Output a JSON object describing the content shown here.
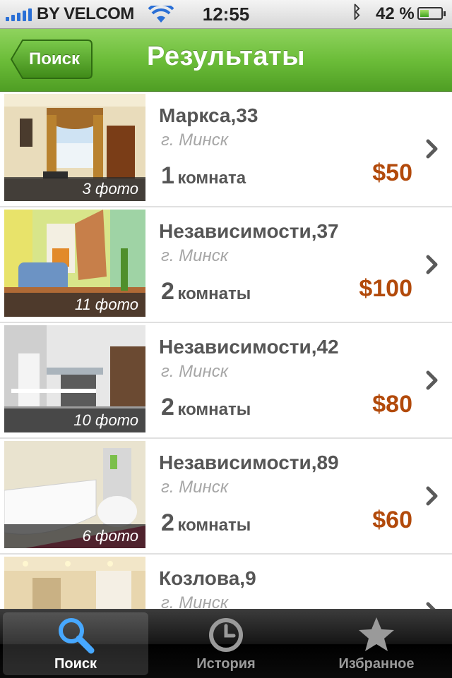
{
  "status_bar": {
    "carrier": "BY VELCOM",
    "time": "12:55",
    "battery_percent_label": "42 %",
    "battery_level": 0.42
  },
  "nav": {
    "back_label": "Поиск",
    "title": "Результаты"
  },
  "listings": [
    {
      "address": "Маркса,33",
      "city": "г. Минск",
      "rooms_num": "1",
      "rooms_word": "комната",
      "price": "$50",
      "photo_count": "3 фото"
    },
    {
      "address": "Независимости,37",
      "city": "г. Минск",
      "rooms_num": "2",
      "rooms_word": "комнаты",
      "price": "$100",
      "photo_count": "11 фото"
    },
    {
      "address": "Независимости,42",
      "city": "г. Минск",
      "rooms_num": "2",
      "rooms_word": "комнаты",
      "price": "$80",
      "photo_count": "10 фото"
    },
    {
      "address": "Независимости,89",
      "city": "г. Минск",
      "rooms_num": "2",
      "rooms_word": "комнаты",
      "price": "$60",
      "photo_count": "6 фото"
    },
    {
      "address": "Козлова,9",
      "city": "г. Минск",
      "rooms_num": "",
      "rooms_word": "",
      "price": "",
      "photo_count": ""
    }
  ],
  "tabs": [
    {
      "label": "Поиск",
      "icon": "search-icon",
      "active": true
    },
    {
      "label": "История",
      "icon": "history-clock-icon",
      "active": false
    },
    {
      "label": "Избранное",
      "icon": "star-icon",
      "active": false
    }
  ],
  "colors": {
    "nav_green": "#6cbd39",
    "price_orange": "#b24a0b",
    "tab_active_blue": "#3aa0ff"
  }
}
